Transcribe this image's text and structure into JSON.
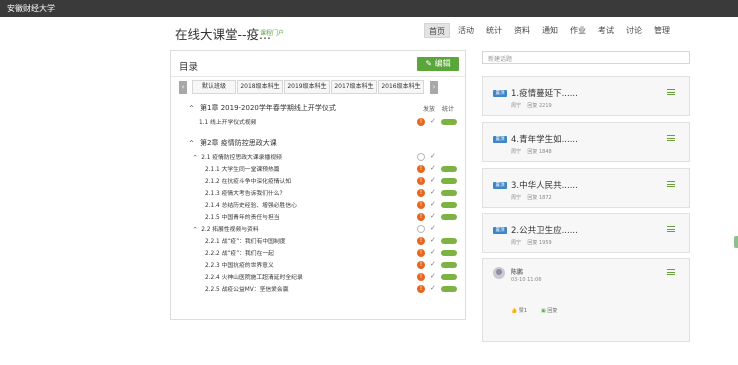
{
  "topbar": {
    "school": "安徽财经大学"
  },
  "header": {
    "course_title": "在线大课堂--疫...",
    "course_sub": "课程门户",
    "nav": [
      "首页",
      "活动",
      "统计",
      "资料",
      "通知",
      "作业",
      "考试",
      "讨论",
      "管理"
    ],
    "active_nav": "首页"
  },
  "catalog": {
    "title": "目录",
    "edit_label": "编辑",
    "tabs": [
      "默认班级",
      "2018级本科生",
      "2019级本科生",
      "2017级本科生",
      "2016级本科生"
    ],
    "col_publish": "发放",
    "col_stats": "统计",
    "chapters": [
      {
        "title": "第1章 2019-2020学年春学期线上开学仪式",
        "items": [
          {
            "label": "1.1 线上开学仪式视频",
            "status": "alert",
            "pill": true,
            "level": 1
          }
        ]
      },
      {
        "title": "第2章 疫情防控思政大课",
        "items": [
          {
            "label": "2.1 疫情防控思政大课录播视频",
            "status": "circle",
            "pill": false,
            "level": 1,
            "caret": true
          },
          {
            "label": "2.1.1 大学生同一堂课预热篇",
            "status": "alert",
            "pill": true,
            "level": 2
          },
          {
            "label": "2.1.2 在抗疫斗争中深化疫情认知",
            "status": "alert",
            "pill": true,
            "level": 2
          },
          {
            "label": "2.1.3 疫情大考告诉我们什么？",
            "status": "alert",
            "pill": true,
            "level": 2
          },
          {
            "label": "2.1.4 总结历史经验、增强必胜信心",
            "status": "alert",
            "pill": true,
            "level": 2
          },
          {
            "label": "2.1.5 中国青年的责任与担当",
            "status": "alert",
            "pill": true,
            "level": 2
          },
          {
            "label": "2.2 拓展性视频与资料",
            "status": "circle",
            "pill": false,
            "level": 1,
            "caret": true
          },
          {
            "label": "2.2.1 战“疫”：我们有中国制度",
            "status": "alert",
            "pill": true,
            "level": 2
          },
          {
            "label": "2.2.2 战“疫”：我们在一起",
            "status": "alert",
            "pill": true,
            "level": 2
          },
          {
            "label": "2.2.3 中国抗疫的世界意义",
            "status": "alert",
            "pill": true,
            "level": 2
          },
          {
            "label": "2.2.4 火神山医院施工超清延时全纪录",
            "status": "alert",
            "pill": true,
            "level": 2
          },
          {
            "label": "2.2.5 战疫公益MV：坚信爱会赢",
            "status": "alert",
            "pill": true,
            "level": 2
          }
        ]
      }
    ]
  },
  "discussion": {
    "new_topic_placeholder": "新建话题",
    "badge_label": "置顶",
    "topics": [
      {
        "title": "1.疫情蔓延下......",
        "author": "周宁",
        "replies": "回复 2219"
      },
      {
        "title": "4.青年学生如......",
        "author": "周宁",
        "replies": "回复 1848"
      },
      {
        "title": "3.中华人民共......",
        "author": "周宁",
        "replies": "回复 1872"
      },
      {
        "title": "2.公共卫生应......",
        "author": "周宁",
        "replies": "回复 1959"
      }
    ],
    "reply": {
      "name": "陈鹏",
      "time": "03-10 11:06",
      "like": "赞1",
      "reply_label": "回复"
    }
  },
  "colors": {
    "accent": "#5aa63a",
    "alert": "#e8671d",
    "badge": "#3f86c8",
    "topbar": "#3a3a3a"
  }
}
